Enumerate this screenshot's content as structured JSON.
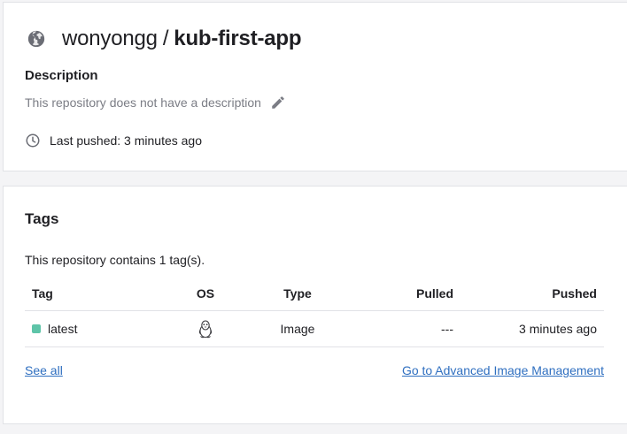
{
  "repository": {
    "namespace": "wonyongg",
    "separator": "/",
    "name": "kub-first-app",
    "description_heading": "Description",
    "description_text": "This repository does not have a description",
    "last_pushed": "Last pushed: 3 minutes ago",
    "icons": {
      "globe": "globe-icon",
      "edit": "pencil-icon",
      "clock": "clock-icon"
    }
  },
  "tags": {
    "heading": "Tags",
    "count_text": "This repository contains 1 tag(s).",
    "columns": [
      "Tag",
      "OS",
      "Type",
      "Pulled",
      "Pushed"
    ],
    "rows": [
      {
        "tag": "latest",
        "os_icon": "linux-tux-icon",
        "type": "Image",
        "pulled": "---",
        "pushed": "3 minutes ago",
        "tag_color": "#5ec4a8"
      }
    ],
    "see_all": "See all",
    "advanced_link": "Go to Advanced Image Management"
  },
  "colors": {
    "link": "#2f6fc0",
    "muted_text": "#7b7d85",
    "border": "#e1e2e6"
  }
}
